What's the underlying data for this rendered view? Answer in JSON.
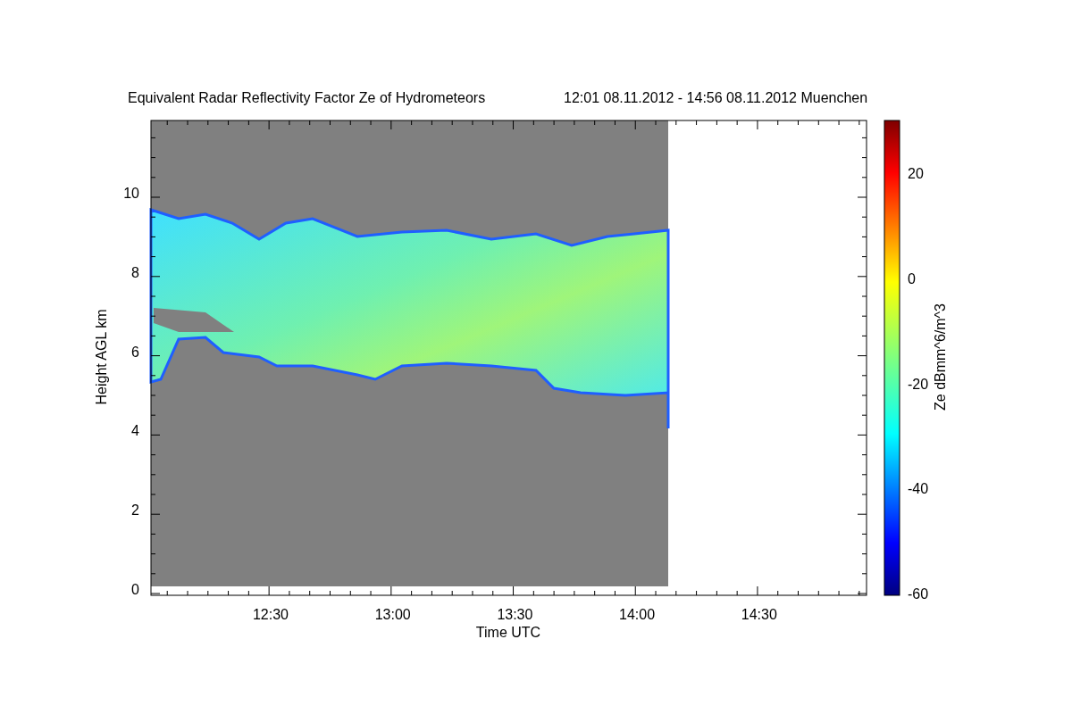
{
  "title": "Equivalent Radar Reflectivity Factor Ze of Hydrometeors",
  "period": "12:01 08.11.2012 - 14:56 08.11.2012 Muenchen",
  "plot": {
    "xlabel": "Time UTC",
    "ylabel": "Height AGL km",
    "xtick_labels": [
      "12:30",
      "13:00",
      "13:30",
      "14:00",
      "14:30"
    ],
    "ytick_labels": [
      "10",
      "8",
      "6",
      "4",
      "2",
      "0"
    ]
  },
  "colorbar": {
    "label": "Ze dBmm^6/m^3",
    "tick_labels": [
      "20",
      "0",
      "-20",
      "-40",
      "-60"
    ]
  }
}
